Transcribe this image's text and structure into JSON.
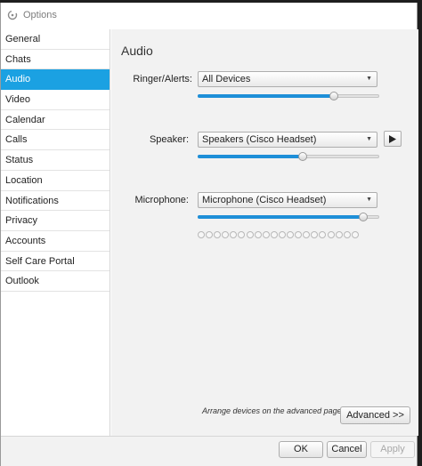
{
  "window": {
    "title": "Options"
  },
  "sidebar": {
    "items": [
      {
        "label": "General"
      },
      {
        "label": "Chats"
      },
      {
        "label": "Audio",
        "active": true
      },
      {
        "label": "Video"
      },
      {
        "label": "Calendar"
      },
      {
        "label": "Calls"
      },
      {
        "label": "Status"
      },
      {
        "label": "Location"
      },
      {
        "label": "Notifications"
      },
      {
        "label": "Privacy"
      },
      {
        "label": "Accounts"
      },
      {
        "label": "Self Care Portal"
      },
      {
        "label": "Outlook"
      }
    ]
  },
  "audio": {
    "title": "Audio",
    "ringer": {
      "label": "Ringer/Alerts:",
      "value": "All Devices",
      "volume_percent": 75
    },
    "speaker": {
      "label": "Speaker:",
      "value": "Speakers (Cisco Headset)",
      "volume_percent": 58
    },
    "microphone": {
      "label": "Microphone:",
      "value": "Microphone (Cisco Headset)",
      "volume_percent": 91,
      "level_dots": 20
    },
    "hint": "Arrange devices on the advanced page.",
    "advanced_label": "Advanced >>"
  },
  "footer": {
    "ok_label": "OK",
    "cancel_label": "Cancel",
    "apply_label": "Apply"
  },
  "colors": {
    "accent": "#1ba1e2",
    "slider_fill": "#1e8fd8"
  },
  "icons": {
    "app": "cisco-jabber-icon",
    "dropdown": "chevron-down-icon",
    "play": "play-icon"
  }
}
